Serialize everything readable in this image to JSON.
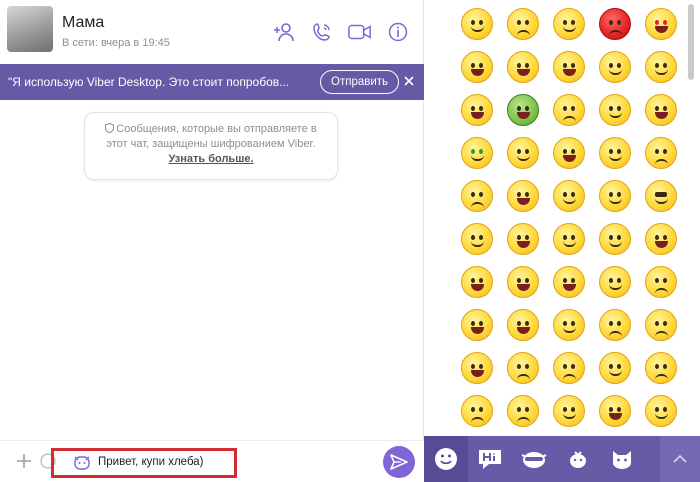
{
  "header": {
    "contact_name": "Мама",
    "contact_status": "В сети: вчера в 19:45",
    "icons": [
      "add-contact-icon",
      "phone-icon",
      "video-icon",
      "info-icon"
    ]
  },
  "banner": {
    "text": "\"Я использую Viber Desktop. Это стоит попробов...",
    "send_label": "Отправить"
  },
  "encryption": {
    "text": "Сообщения, которые вы отправляете в этот чат, защищены шифрованием Viber.",
    "learn_more": "Узнать больше."
  },
  "composer": {
    "message_value": "Привет, купи хлеба)",
    "highlight_color": "#d52b34"
  },
  "colors": {
    "accent": "#665aa6",
    "send_button": "#7f66d6",
    "emoji_yellow": "#ffd93b"
  },
  "emoji_panel": {
    "tabs": [
      "smiley-icon",
      "hi-sticker-icon",
      "cool-cat-sticker-icon",
      "chicken-sticker-icon",
      "cat-sticker-icon"
    ],
    "active_tab": "smiley-icon"
  }
}
